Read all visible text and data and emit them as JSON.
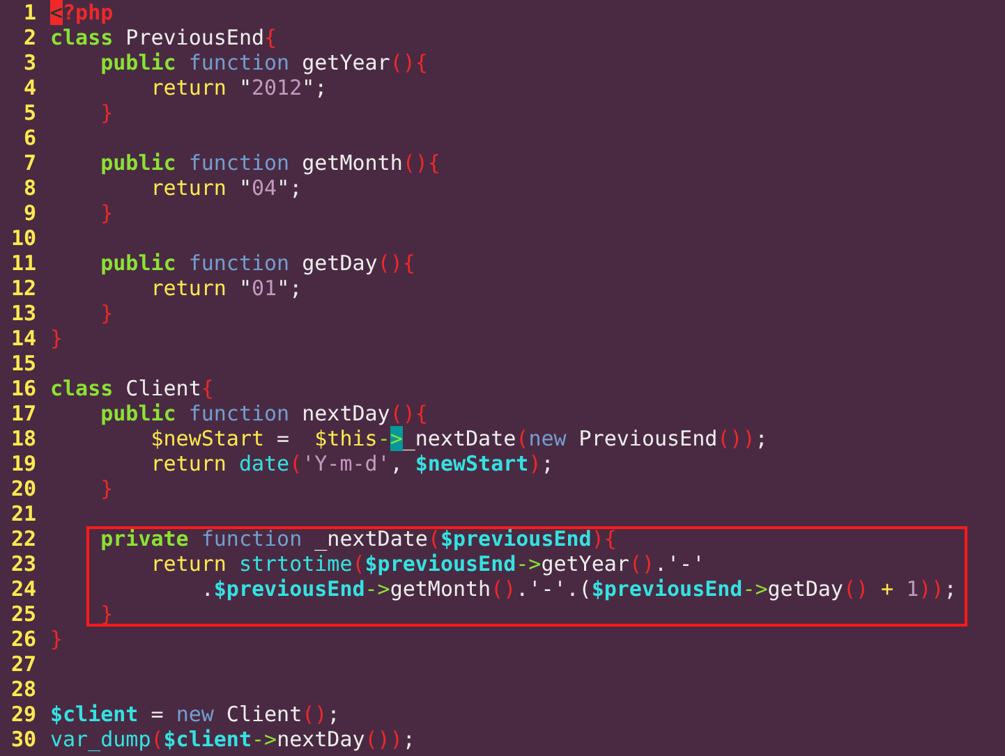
{
  "editor": {
    "lines": [
      {
        "number": "1",
        "boxed": false,
        "tokens": [
          {
            "kind": "cursor_red",
            "text": "<"
          },
          {
            "kind": "php",
            "text": "?php"
          }
        ]
      },
      {
        "number": "2",
        "boxed": false,
        "tokens": [
          {
            "kind": "kw",
            "text": "class"
          },
          {
            "kind": "plain",
            "text": " PreviousEnd"
          },
          {
            "kind": "brace",
            "text": "{"
          }
        ]
      },
      {
        "number": "3",
        "boxed": false,
        "tokens": [
          {
            "kind": "kw",
            "text": "    public"
          },
          {
            "kind": "storage",
            "text": " function"
          },
          {
            "kind": "plain",
            "text": " getYear"
          },
          {
            "kind": "brace",
            "text": "(){"
          }
        ]
      },
      {
        "number": "4",
        "boxed": false,
        "tokens": [
          {
            "kind": "ret",
            "text": "        return"
          },
          {
            "kind": "plain",
            "text": " \""
          },
          {
            "kind": "str",
            "text": "2012"
          },
          {
            "kind": "plain",
            "text": "\";"
          }
        ]
      },
      {
        "number": "5",
        "boxed": false,
        "tokens": [
          {
            "kind": "brace",
            "text": "    }"
          }
        ]
      },
      {
        "number": "6",
        "boxed": false
      },
      {
        "number": "7",
        "boxed": false,
        "tokens": [
          {
            "kind": "kw",
            "text": "    public"
          },
          {
            "kind": "storage",
            "text": " function"
          },
          {
            "kind": "plain",
            "text": " getMonth"
          },
          {
            "kind": "brace",
            "text": "(){"
          }
        ]
      },
      {
        "number": "8",
        "boxed": false,
        "tokens": [
          {
            "kind": "ret",
            "text": "        return"
          },
          {
            "kind": "plain",
            "text": " \""
          },
          {
            "kind": "str",
            "text": "04"
          },
          {
            "kind": "plain",
            "text": "\";"
          }
        ]
      },
      {
        "number": "9",
        "boxed": false,
        "tokens": [
          {
            "kind": "brace",
            "text": "    }"
          }
        ]
      },
      {
        "number": "10",
        "boxed": false
      },
      {
        "number": "11",
        "boxed": false,
        "tokens": [
          {
            "kind": "kw",
            "text": "    public"
          },
          {
            "kind": "storage",
            "text": " function"
          },
          {
            "kind": "plain",
            "text": " getDay"
          },
          {
            "kind": "brace",
            "text": "(){"
          }
        ]
      },
      {
        "number": "12",
        "boxed": false,
        "tokens": [
          {
            "kind": "ret",
            "text": "        return"
          },
          {
            "kind": "plain",
            "text": " \""
          },
          {
            "kind": "str",
            "text": "01"
          },
          {
            "kind": "plain",
            "text": "\";"
          }
        ]
      },
      {
        "number": "13",
        "boxed": false,
        "tokens": [
          {
            "kind": "brace",
            "text": "    }"
          }
        ]
      },
      {
        "number": "14",
        "boxed": false,
        "tokens": [
          {
            "kind": "brace",
            "text": "}"
          }
        ]
      },
      {
        "number": "15",
        "boxed": false
      },
      {
        "number": "16",
        "boxed": false,
        "tokens": [
          {
            "kind": "kw",
            "text": "class"
          },
          {
            "kind": "plain",
            "text": " Client"
          },
          {
            "kind": "brace",
            "text": "{"
          }
        ]
      },
      {
        "number": "17",
        "boxed": false,
        "tokens": [
          {
            "kind": "kw",
            "text": "    public"
          },
          {
            "kind": "storage",
            "text": " function"
          },
          {
            "kind": "plain",
            "text": " nextDay"
          },
          {
            "kind": "brace",
            "text": "(){"
          }
        ]
      },
      {
        "number": "18",
        "boxed": false,
        "tokens": [
          {
            "kind": "yvar",
            "text": "        $newStart"
          },
          {
            "kind": "plain",
            "text": " =  "
          },
          {
            "kind": "yvar",
            "text": "$this"
          },
          {
            "kind": "arrow",
            "text": "-"
          },
          {
            "kind": "cursor_teal",
            "text": ">"
          },
          {
            "kind": "plain",
            "text": "_nextDate"
          },
          {
            "kind": "brace",
            "text": "("
          },
          {
            "kind": "storage",
            "text": "new"
          },
          {
            "kind": "plain",
            "text": " PreviousEnd"
          },
          {
            "kind": "brace",
            "text": "())"
          },
          {
            "kind": "plain",
            "text": ";"
          }
        ]
      },
      {
        "number": "19",
        "boxed": false,
        "tokens": [
          {
            "kind": "ret",
            "text": "        return"
          },
          {
            "kind": "func",
            "text": " date"
          },
          {
            "kind": "brace",
            "text": "("
          },
          {
            "kind": "str",
            "text": "'Y-m-d'"
          },
          {
            "kind": "plain",
            "text": ","
          },
          {
            "kind": "var",
            "text": " $newStart"
          },
          {
            "kind": "brace",
            "text": ")"
          },
          {
            "kind": "plain",
            "text": ";"
          }
        ]
      },
      {
        "number": "20",
        "boxed": false,
        "tokens": [
          {
            "kind": "brace",
            "text": "    }"
          }
        ]
      },
      {
        "number": "21",
        "boxed": false
      },
      {
        "number": "22",
        "boxed": true,
        "tokens": [
          {
            "kind": "kw",
            "text": "    private"
          },
          {
            "kind": "storage",
            "text": " function"
          },
          {
            "kind": "plain",
            "text": " _nextDate"
          },
          {
            "kind": "brace",
            "text": "("
          },
          {
            "kind": "var",
            "text": "$previousEnd"
          },
          {
            "kind": "brace",
            "text": "){"
          }
        ]
      },
      {
        "number": "23",
        "boxed": true,
        "tokens": [
          {
            "kind": "ret",
            "text": "        return"
          },
          {
            "kind": "func",
            "text": " strtotime"
          },
          {
            "kind": "brace",
            "text": "("
          },
          {
            "kind": "var",
            "text": "$previousEnd"
          },
          {
            "kind": "arrow",
            "text": "->"
          },
          {
            "kind": "plain",
            "text": "getYear"
          },
          {
            "kind": "brace",
            "text": "()"
          },
          {
            "kind": "plain",
            "text": ".'-'"
          }
        ]
      },
      {
        "number": "24",
        "boxed": true,
        "tokens": [
          {
            "kind": "plain",
            "text": "            ."
          },
          {
            "kind": "var",
            "text": "$previousEnd"
          },
          {
            "kind": "arrow",
            "text": "->"
          },
          {
            "kind": "plain",
            "text": "getMonth"
          },
          {
            "kind": "brace",
            "text": "()"
          },
          {
            "kind": "plain",
            "text": ".'-'.("
          },
          {
            "kind": "var",
            "text": "$previousEnd"
          },
          {
            "kind": "arrow",
            "text": "->"
          },
          {
            "kind": "plain",
            "text": "getDay"
          },
          {
            "kind": "brace",
            "text": "()"
          },
          {
            "kind": "op",
            "text": " + "
          },
          {
            "kind": "str",
            "text": "1"
          },
          {
            "kind": "brace",
            "text": "))"
          },
          {
            "kind": "plain",
            "text": ";"
          }
        ]
      },
      {
        "number": "25",
        "boxed": true,
        "tokens": [
          {
            "kind": "brace",
            "text": "    }"
          }
        ]
      },
      {
        "number": "26",
        "boxed": false,
        "tokens": [
          {
            "kind": "brace",
            "text": "}"
          }
        ]
      },
      {
        "number": "27",
        "boxed": false
      },
      {
        "number": "28",
        "boxed": false
      },
      {
        "number": "29",
        "boxed": false,
        "tokens": [
          {
            "kind": "var",
            "text": "$client"
          },
          {
            "kind": "plain",
            "text": " = "
          },
          {
            "kind": "storage",
            "text": "new"
          },
          {
            "kind": "plain",
            "text": " Client"
          },
          {
            "kind": "brace",
            "text": "()"
          },
          {
            "kind": "plain",
            "text": ";"
          }
        ]
      },
      {
        "number": "30",
        "boxed": false,
        "tokens": [
          {
            "kind": "func",
            "text": "var_dump"
          },
          {
            "kind": "brace",
            "text": "("
          },
          {
            "kind": "var",
            "text": "$client"
          },
          {
            "kind": "arrow",
            "text": "->"
          },
          {
            "kind": "plain",
            "text": "nextDay"
          },
          {
            "kind": "brace",
            "text": "())"
          },
          {
            "kind": "plain",
            "text": ";"
          }
        ]
      }
    ]
  }
}
